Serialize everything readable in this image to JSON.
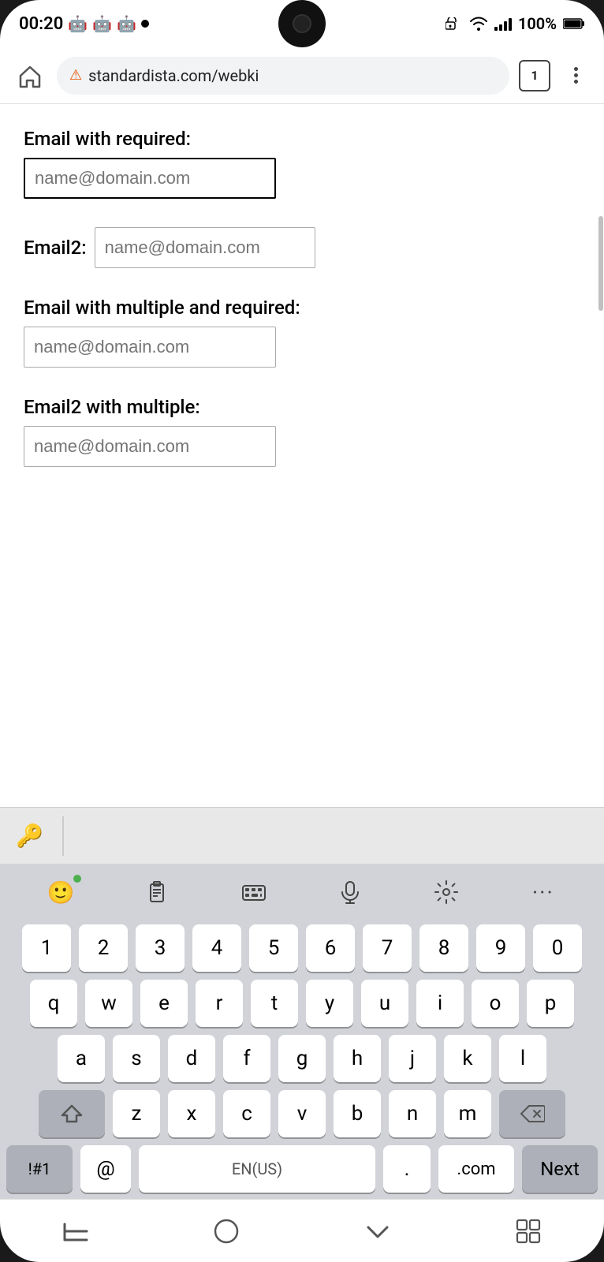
{
  "statusBar": {
    "time": "00:20",
    "battery": "100%",
    "tabCount": "1"
  },
  "browserBar": {
    "url": "standardista.com/webki",
    "warningSymbol": "⚠"
  },
  "form": {
    "field1": {
      "label": "Email with required:",
      "placeholder": "name@domain.com"
    },
    "field2": {
      "label": "Email2:",
      "placeholder": "name@domain.com"
    },
    "field3": {
      "label": "Email with multiple and required:",
      "placeholder": "name@domain.com"
    },
    "field4": {
      "label": "Email2 with multiple:",
      "placeholder": "name@domain.com"
    }
  },
  "keyboard": {
    "row1": [
      "1",
      "2",
      "3",
      "4",
      "5",
      "6",
      "7",
      "8",
      "9",
      "0"
    ],
    "row2": [
      "q",
      "w",
      "e",
      "r",
      "t",
      "y",
      "u",
      "i",
      "o",
      "p"
    ],
    "row3": [
      "a",
      "s",
      "d",
      "f",
      "g",
      "h",
      "j",
      "k",
      "l"
    ],
    "row4": [
      "z",
      "x",
      "c",
      "v",
      "b",
      "n",
      "m"
    ],
    "bottom": {
      "special": "!#1",
      "at": "@",
      "space": "EN(US)",
      "dot": ".",
      "dotcom": ".com",
      "next": "Next"
    }
  },
  "bottomNav": {
    "back": "|||",
    "home": "○",
    "down": "∨",
    "grid": "⊞"
  }
}
